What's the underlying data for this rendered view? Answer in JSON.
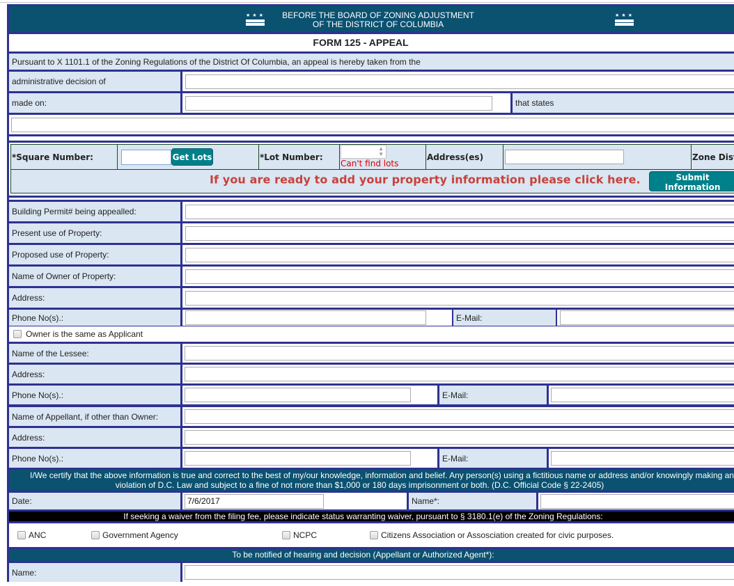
{
  "header": {
    "line1": "BEFORE THE BOARD OF ZONING ADJUSTMENT",
    "line2": "OF THE DISTRICT OF COLUMBIA",
    "left_icon": "dc-flag-icon",
    "right_icon": "dc-flag-icon",
    "stars": "★ ★ ★"
  },
  "form_title": "FORM 125 - APPEAL",
  "intro_text": "Pursuant to X 1101.1 of the Zoning Regulations of the District Of Columbia, an appeal is hereby taken from the",
  "decision": {
    "admin_decision_label": "administrative decision of",
    "admin_decision_value": "",
    "made_on_label": "made on:",
    "made_on_value": "",
    "that_states_label": "that states",
    "that_states_value": ""
  },
  "property": {
    "square_label": "*Square Number:",
    "square_value": "",
    "get_lots_button": "Get Lots",
    "lot_label": "*Lot Number:",
    "lot_value": "",
    "lot_error": "Can't find lots",
    "address_label": "Address(es)",
    "address_value": "",
    "zone_label": "Zone Dist",
    "ready_text": "If you are ready to add your property information please click here.",
    "submit_button": "Submit Information"
  },
  "owner_section": {
    "building_permit_label": "Building Permit# being appealled:",
    "present_use_label": "Present use of Property:",
    "proposed_use_label": "Proposed use of Property:",
    "owner_name_label": "Name of Owner of Property:",
    "address_label": "Address:",
    "phone_label": "Phone No(s).:",
    "email_label": "E-Mail:",
    "same_as_applicant_label": "Owner is the same as Applicant",
    "same_as_applicant_checked": false
  },
  "lessee_section": {
    "name_label": "Name of the Lessee:",
    "address_label": "Address:",
    "phone_label": "Phone No(s).:",
    "email_label": "E-Mail:"
  },
  "appellant_section": {
    "name_label": "Name of Appellant, if other than Owner:",
    "address_label": "Address:",
    "phone_label": "Phone No(s).:",
    "email_label": "E-Mail:"
  },
  "certification": {
    "line1": "I/We certify that the above information is true and correct to the best of my/our knowledge, information and belief. Any person(s) using a fictitious name or address and/or knowingly making any f",
    "line2": "violation of D.C. Law and subject to a fine of not more than $1,000 or 180 days imprisonment or both. (D.C. Official Code § 22-2405)",
    "date_label": "Date:",
    "date_value": "7/6/2017",
    "name_label": "Name*:",
    "name_value": ""
  },
  "waiver": {
    "banner": "If seeking a waiver from the filing fee, please indicate status warranting waiver, pursuant to § 3180.1(e) of the Zoning Regulations:",
    "options": [
      {
        "label": "ANC",
        "checked": false
      },
      {
        "label": "Government Agency",
        "checked": false
      },
      {
        "label": "NCPC",
        "checked": false
      },
      {
        "label": "Citizens Association or Assosciation created for civic purposes.",
        "checked": false
      }
    ]
  },
  "notify": {
    "banner": "To be notified of hearing and decision (Appellant or Authorized Agent*):",
    "name_label": "Name:",
    "name_value": ""
  },
  "colors": {
    "border": "#2e3192",
    "header_bg": "#0b5170",
    "label_bg": "#dae6f2",
    "button_teal": "#00808a",
    "error_red": "#e00000",
    "ready_text_red": "#c8413a"
  }
}
